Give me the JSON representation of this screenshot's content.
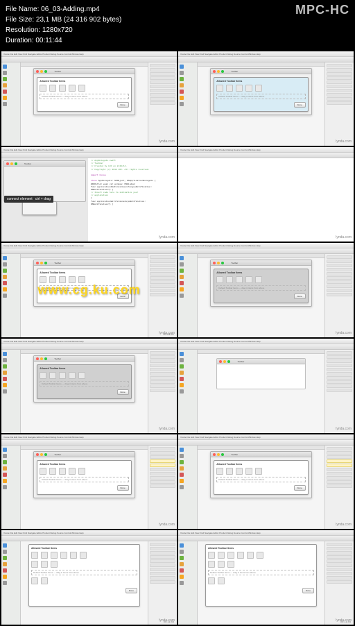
{
  "player": {
    "logo": "MPC-HC",
    "file_name_label": "File Name:",
    "file_name": "06_03-Adding.mp4",
    "file_size_label": "File Size:",
    "file_size": "23,1 MB (24 316 902 bytes)",
    "resolution_label": "Resolution:",
    "resolution": "1280x720",
    "duration_label": "Duration:",
    "duration": "00:11:44"
  },
  "common": {
    "toolbar_title": "Toolbar",
    "sheet_heading": "Allowed Toolbar Items",
    "default_label": "Default Toolbar Items — drag in items from above",
    "done_button": "Done",
    "window_menu": "Xcode File Edit View Find Navigate Editor Product Debug Source Control Window Help",
    "lynda": "lynda.com"
  },
  "thumbs": [
    {
      "kind": "xcode-sheet",
      "sheet": "light",
      "ts_left": "",
      "ts_right": "",
      "sidebar": true,
      "rightpanel": true
    },
    {
      "kind": "xcode-sheet",
      "sheet": "blue",
      "ts_left": "",
      "ts_right": "",
      "sidebar": true,
      "rightpanel": true
    },
    {
      "kind": "xcode-code",
      "ts_left": "",
      "ts_right": "",
      "tooltip_l": "connect element",
      "tooltip_r": "ctrl + drag"
    },
    {
      "kind": "xcode-blank",
      "ts_left": "",
      "ts_right": ""
    },
    {
      "kind": "xcode-sheet",
      "sheet": "light",
      "ts_left": "",
      "ts_right": "00:04:51",
      "watermark": "www.cg.ku.com",
      "sidebar": true,
      "rightpanel": true
    },
    {
      "kind": "xcode-sheet",
      "sheet": "gray",
      "ts_left": "",
      "ts_right": "",
      "sidebar": true,
      "rightpanel": true
    },
    {
      "kind": "xcode-sheet",
      "sheet": "gray",
      "ts_left": "",
      "ts_right": "",
      "sidebar": true,
      "rightpanel": true
    },
    {
      "kind": "xcode-empty-canvas",
      "ts_left": "",
      "ts_right": "",
      "sidebar": true,
      "rightpanel": true
    },
    {
      "kind": "xcode-sheet",
      "sheet": "light",
      "ts_left": "",
      "ts_right": "",
      "sidebar": true,
      "rightpanel": true,
      "hl_right": true
    },
    {
      "kind": "xcode-sheet",
      "sheet": "light",
      "ts_left": "",
      "ts_right": "",
      "sidebar": true,
      "rightpanel": true,
      "hl_right": true
    },
    {
      "kind": "xcode-bigsheet",
      "sheet": "light",
      "ts_left": "",
      "ts_right": "00:11:44",
      "sidebar": true,
      "rightpanel": true
    },
    {
      "kind": "xcode-bigsheet",
      "sheet": "light",
      "ts_left": "",
      "ts_right": "00:11:44",
      "sidebar": true,
      "rightpanel": true
    }
  ],
  "code": {
    "line1": "// AppDelegate.swift",
    "line2": "// Toolbar",
    "line3": "// Created by LDC on 8/20/14.",
    "line4": "// Copyright (c) 2014 LDC. All rights reserved.",
    "line5": "import Cocoa",
    "line6": "class AppDelegate: NSObject, NSApplicationDelegate {",
    "line7": "  @IBOutlet weak var window: NSWindow!",
    "line8": "  func applicationDidFinishLaunching(aNotification:",
    "line9": "      NSNotification?) {",
    "line10": "    // Insert code here to initialize your",
    "line11": "    // application",
    "line12": "  }",
    "line13": "  func applicationWillTerminate(aNotification:",
    "line14": "      NSNotification?) {"
  }
}
